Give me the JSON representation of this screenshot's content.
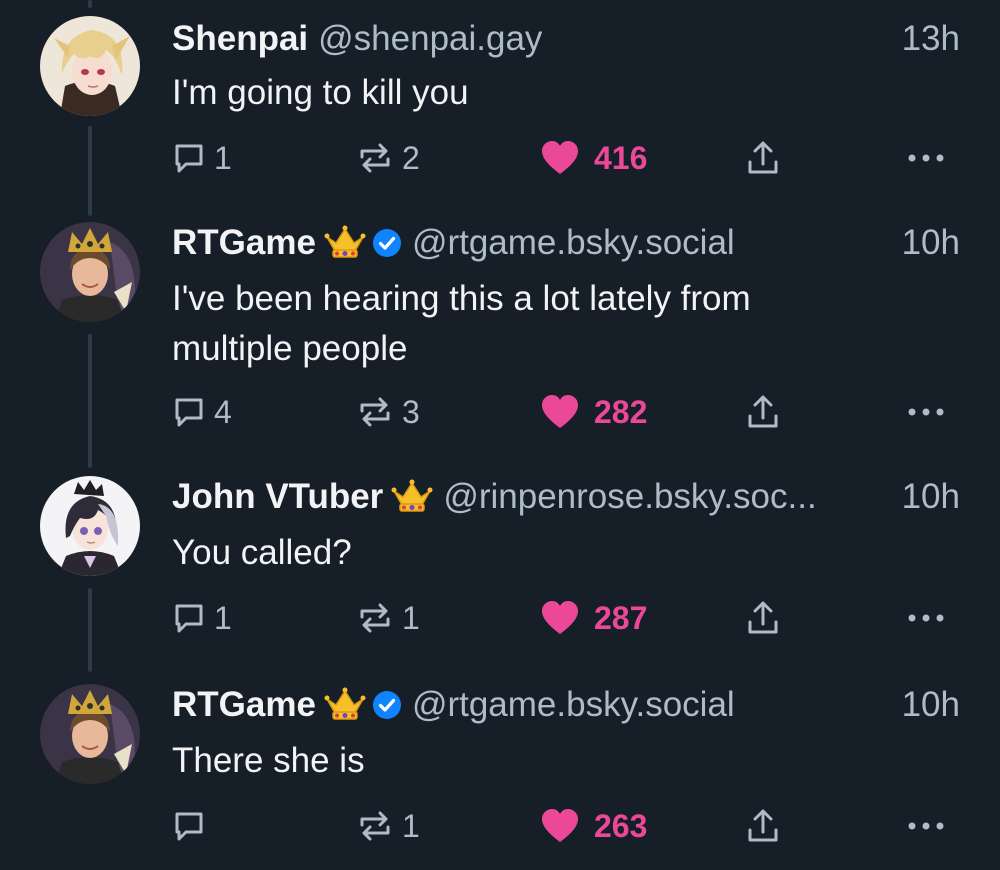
{
  "colors": {
    "background": "#161e27",
    "text": "#f1f3f5",
    "muted": "#aebbc9",
    "like": "#ec4899",
    "verified": "#1083fe",
    "thread_line": "#2e3a47"
  },
  "posts": [
    {
      "display_name": "Shenpai",
      "handle": "@shenpai.gay",
      "time": "13h",
      "text": "I'm going to kill you",
      "crown": false,
      "verified": false,
      "replies": "1",
      "reposts": "2",
      "likes": "416",
      "avatar": "anime-blonde-avatar"
    },
    {
      "display_name": "RTGame",
      "handle": "@rtgame.bsky.social",
      "time": "10h",
      "text": "I've been hearing this a lot lately from multiple people",
      "crown": true,
      "verified": true,
      "replies": "4",
      "reposts": "3",
      "likes": "282",
      "avatar": "crowned-person-avatar"
    },
    {
      "display_name": "John VTuber",
      "handle": "@rinpenrose.bsky.soc...",
      "time": "10h",
      "text": "You called?",
      "crown": true,
      "verified": false,
      "replies": "1",
      "reposts": "1",
      "likes": "287",
      "avatar": "anime-dark-hair-avatar"
    },
    {
      "display_name": "RTGame",
      "handle": "@rtgame.bsky.social",
      "time": "10h",
      "text": "There she is",
      "crown": true,
      "verified": true,
      "replies": "",
      "reposts": "1",
      "likes": "263",
      "avatar": "crowned-person-avatar"
    }
  ],
  "icons": {
    "reply": "speech-bubble-icon",
    "repost": "repost-arrows-icon",
    "like": "heart-icon",
    "share": "share-upload-icon",
    "more": "ellipsis-icon",
    "crown": "crown-emoji-icon",
    "verified": "verified-check-icon"
  }
}
